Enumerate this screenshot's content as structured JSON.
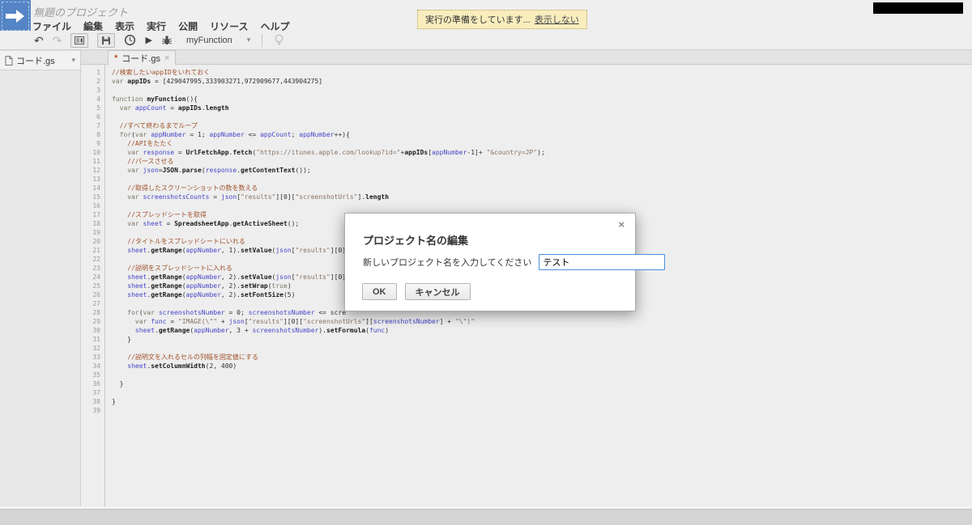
{
  "window": {
    "title": "無題のプロジェクト",
    "menus": [
      "ファイル",
      "編集",
      "表示",
      "実行",
      "公開",
      "リソース",
      "ヘルプ"
    ],
    "toast": {
      "message": "実行の準備をしています...",
      "dismiss_label": "表示しない"
    }
  },
  "toolbar": {
    "function_select": {
      "value": "myFunction"
    }
  },
  "icons": {
    "undo": "↶",
    "redo": "↷",
    "run": "▶",
    "caret": "▾",
    "close": "×",
    "dirty": "*"
  },
  "sidebar": {
    "files": [
      {
        "name": "コード.gs"
      }
    ]
  },
  "tabs": [
    {
      "label": "コード.gs",
      "dirty": true
    }
  ],
  "editor": {
    "highlight": {
      "keywords": [
        "var",
        "function",
        "for",
        "true"
      ],
      "variables": [
        "appCount",
        "appNumber",
        "response",
        "json",
        "sheet",
        "screenshotsCounts",
        "screenshotsNumber",
        "func"
      ],
      "builtins": [
        "appIDs",
        "UrlFetchApp",
        "fetch",
        "JSON",
        "parse",
        "getContentText",
        "SpreadsheetApp",
        "getActiveSheet",
        "getRange",
        "setValue",
        "setWrap",
        "setFontSize",
        "setFormula",
        "setColumnWidth",
        "length",
        "myFunction"
      ]
    },
    "lines": [
      "//検索したいappIDをいれておく",
      "var appIDs = [429047995,333903271,972909677,443904275]",
      "",
      "function myFunction(){",
      "  var appCount = appIDs.length",
      "",
      "  //すべて終わるまでループ",
      "  for(var appNumber = 1; appNumber <= appCount; appNumber++){",
      "    //APIをたたく",
      "    var response = UrlFetchApp.fetch(\"https://itunes.apple.com/lookup?id=\"+appIDs[appNumber-1]+ \"&country=JP\");",
      "    //パースさせる",
      "    var json=JSON.parse(response.getContentText());",
      "",
      "    //取得したスクリーンショットの数を数える",
      "    var screenshotsCounts = json[\"results\"][0][\"screenshotUrls\"].length",
      "",
      "    //スプレッドシートを取得",
      "    var sheet = SpreadsheetApp.getActiveSheet();",
      "",
      "    //タイトルをスプレッドシートにいれる",
      "    sheet.getRange(appNumber, 1).setValue(json[\"results\"][0]",
      "",
      "    //説明をスプレッドシートに入れる",
      "    sheet.getRange(appNumber, 2).setValue(json[\"results\"][0]",
      "    sheet.getRange(appNumber, 2).setWrap(true)",
      "    sheet.getRange(appNumber, 2).setFontSize(5)",
      "",
      "    for(var screenshotsNumber = 0; screenshotsNumber <= scre",
      "      var func = \"IMAGE(\\\"\" + json[\"results\"][0][\"screenshotUrls\"][screenshotsNumber] + \"\\\")\"",
      "      sheet.getRange(appNumber, 3 + screenshotsNumber).setFormula(func)",
      "    }",
      "",
      "    //説明文を入れるセルの列幅を固定値にする",
      "    sheet.setColumnWidth(2, 400)",
      "",
      "  }",
      "",
      "}",
      ""
    ]
  },
  "dialog": {
    "title": "プロジェクト名の編集",
    "label": "新しいプロジェクト名を入力してください",
    "input_value": "テスト",
    "ok_label": "OK",
    "cancel_label": "キャンセル"
  },
  "colors": {
    "logo_blue": "#5585c6",
    "toast_bg": "#f9edbe",
    "comment": "#a0512b",
    "variable": "#4646c8",
    "string": "#8a7264",
    "keyword": "#7d7668",
    "input_focus_border": "#4a90e2"
  }
}
